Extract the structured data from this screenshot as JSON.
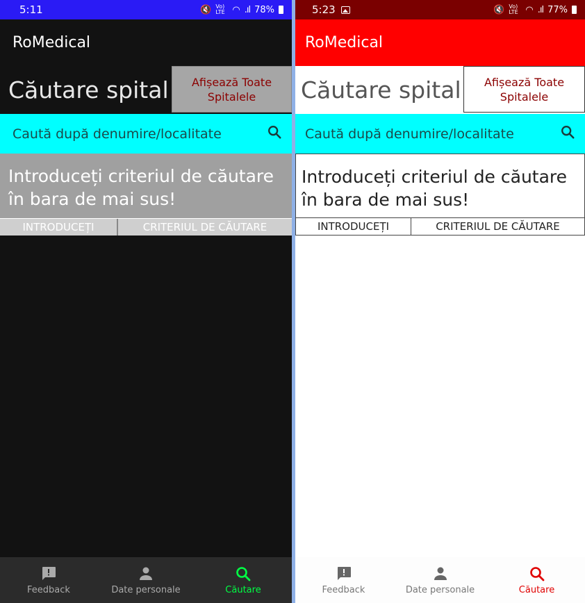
{
  "colors": {
    "dark_status": "#2a1bf5",
    "light_status": "#7a0000",
    "light_appbar": "#ff0000",
    "search_bg": "#00ffff",
    "showall_text": "#8b0000",
    "dark_active_nav": "#00ff44",
    "light_active_nav": "#e00000"
  },
  "left": {
    "status": {
      "time": "5:11",
      "net": "Vo) LTE",
      "battery": "78%"
    },
    "app_title": "RoMedical",
    "page_title": "Căutare spital",
    "show_all": "Afișează Toate Spitalele",
    "search_placeholder": "Caută după denumire/localitate",
    "info_text": "Introduceți criteriul de căutare în bara de mai sus!",
    "crit_left": "INTRODUCEȚI",
    "crit_right": "CRITERIUL DE CĂUTARE",
    "nav": {
      "feedback": "Feedback",
      "personal": "Date personale",
      "search": "Căutare"
    }
  },
  "right": {
    "status": {
      "time": "5:23",
      "net": "Vo) LTE",
      "battery": "77%"
    },
    "app_title": "RoMedical",
    "page_title": "Căutare spital",
    "show_all": "Afișează Toate Spitalele",
    "search_placeholder": "Caută după denumire/localitate",
    "info_text": "Introduceți criteriul de căutare în bara de mai sus!",
    "crit_left": "INTRODUCEȚI",
    "crit_right": "CRITERIUL DE CĂUTARE",
    "nav": {
      "feedback": "Feedback",
      "personal": "Date personale",
      "search": "Căutare"
    }
  },
  "icons": {
    "search": "search-icon",
    "feedback": "feedback-icon",
    "person": "person-icon",
    "gallery": "image-icon",
    "mute": "mute-icon",
    "wifi": "wifi-icon",
    "signal": "signal-icon",
    "battery": "battery-icon"
  }
}
